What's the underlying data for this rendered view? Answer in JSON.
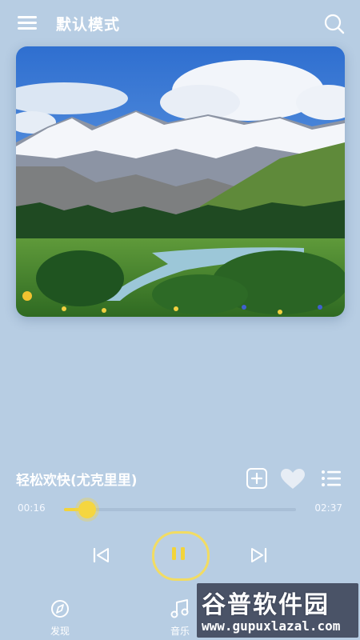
{
  "header": {
    "title": "默认模式",
    "menu_icon": "hamburger-menu-icon",
    "search_icon": "search-icon"
  },
  "cover": {
    "description_icon": "album-cover-image"
  },
  "song": {
    "title": "轻松欢快(尤克里里)",
    "add_icon": "plus-box-icon",
    "like_icon": "heart-icon",
    "playlist_icon": "playlist-icon"
  },
  "progress": {
    "current": "00:16",
    "total": "02:37",
    "fraction": 0.1
  },
  "controls": {
    "prev_icon": "skip-previous-icon",
    "play_icon": "pause-icon",
    "next_icon": "skip-next-icon"
  },
  "nav": {
    "items": [
      {
        "label": "发现",
        "icon": "compass-icon"
      },
      {
        "label": "音乐",
        "icon": "music-note-icon"
      }
    ]
  },
  "watermark": {
    "brand": "谷普软件园",
    "url": "www.gupuxlazal.com"
  },
  "colors": {
    "background": "#b7cde3",
    "accent": "#f3d43b",
    "text": "#ffffff"
  }
}
